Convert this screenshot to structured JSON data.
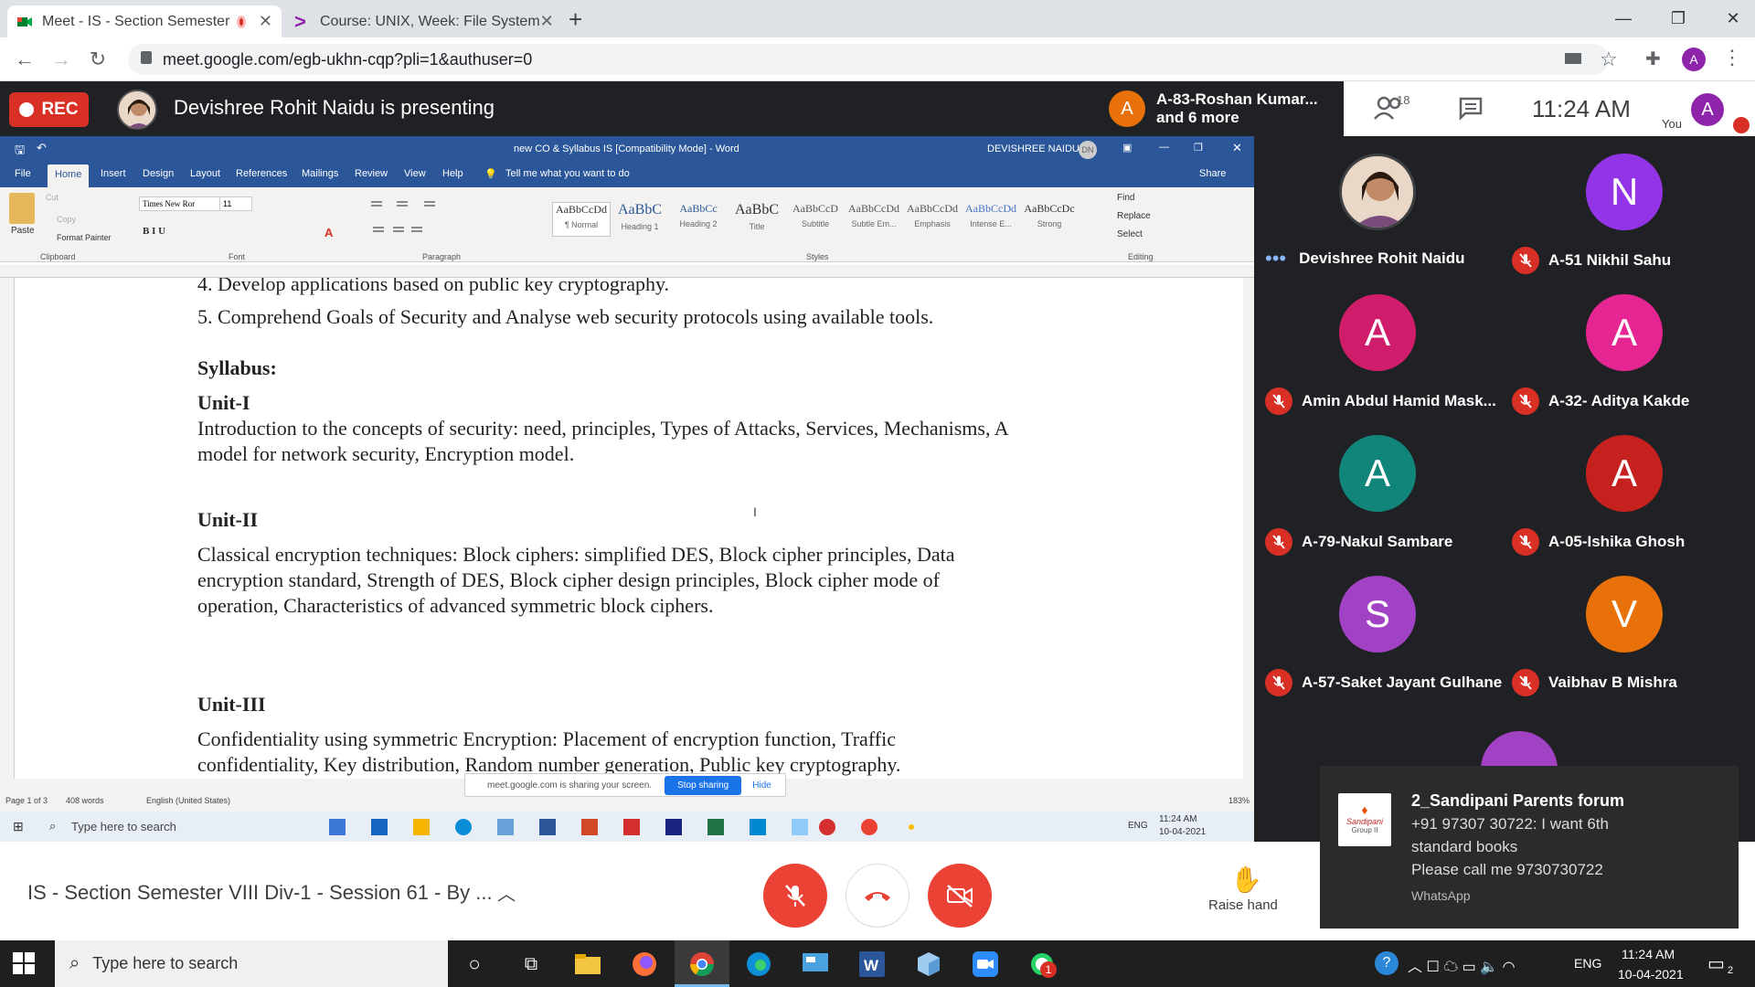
{
  "browser": {
    "tabs": [
      {
        "label": "Meet - IS - Section Semester",
        "active": true
      },
      {
        "label": "Course: UNIX, Week: File System",
        "active": false
      }
    ],
    "new_tab": "+",
    "url": "meet.google.com/egb-ukhn-cqp?pli=1&authuser=0",
    "profile_initial": "A"
  },
  "meet": {
    "rec_label": "REC",
    "presenter_text": "Devishree Rohit Naidu is presenting",
    "joiner_initial": "A",
    "joiner_line1": "A-83-Roshan Kumar...",
    "joiner_line2": "and 6 more",
    "participant_count": "18",
    "time": "11:24 AM",
    "you_label": "You",
    "you_initial": "A",
    "meeting_title": "IS - Section Semester VIII Div-1 - Session 61 - By ...",
    "raise_hand": "Raise hand",
    "participants": [
      {
        "name": "Devishree Rohit Naidu",
        "initial": "",
        "color": "#c9a58b",
        "muted": false
      },
      {
        "name": "A-51 Nikhil Sahu",
        "initial": "N",
        "color": "#9334e6",
        "muted": true
      },
      {
        "name": "Amin Abdul Hamid Mask...",
        "initial": "A",
        "color": "#d01d6b",
        "muted": true
      },
      {
        "name": "A-32- Aditya Kakde",
        "initial": "A",
        "color": "#e52592",
        "muted": true
      },
      {
        "name": "A-79-Nakul Sambare",
        "initial": "A",
        "color": "#12857a",
        "muted": true
      },
      {
        "name": "A-05-Ishika Ghosh",
        "initial": "A",
        "color": "#c5221f",
        "muted": true
      },
      {
        "name": "A-57-Saket Jayant Gulhane",
        "initial": "S",
        "color": "#a142c4",
        "muted": true
      },
      {
        "name": "Vaibhav B Mishra",
        "initial": "V",
        "color": "#e8710a",
        "muted": true
      }
    ]
  },
  "word": {
    "title": "new CO & Syllabus IS [Compatibility Mode] - Word",
    "user": "DEVISHREE NAIDU",
    "user_initials": "DN",
    "share_label": "Share",
    "tabs": [
      "File",
      "Home",
      "Insert",
      "Design",
      "Layout",
      "References",
      "Mailings",
      "Review",
      "View",
      "Help"
    ],
    "tell_me": "Tell me what you want to do",
    "clipboard": {
      "paste": "Paste",
      "cut": "Cut",
      "copy": "Copy",
      "format_painter": "Format Painter",
      "group": "Clipboard"
    },
    "font": {
      "name": "Times New Ror",
      "size": "11",
      "group": "Font"
    },
    "paragraph_group": "Paragraph",
    "styles": [
      {
        "sample": "AaBbCcDd",
        "label": "¶ Normal"
      },
      {
        "sample": "AaBbC",
        "label": "Heading 1"
      },
      {
        "sample": "AaBbCc",
        "label": "Heading 2"
      },
      {
        "sample": "AaBbC",
        "label": "Title"
      },
      {
        "sample": "AaBbCcD",
        "label": "Subtitle"
      },
      {
        "sample": "AaBbCcDd",
        "label": "Subtle Em..."
      },
      {
        "sample": "AaBbCcDd",
        "label": "Emphasis"
      },
      {
        "sample": "AaBbCcDd",
        "label": "Intense E..."
      },
      {
        "sample": "AaBbCcDc",
        "label": "Strong"
      }
    ],
    "styles_group": "Styles",
    "editing": {
      "find": "Find",
      "replace": "Replace",
      "select": "Select",
      "group": "Editing"
    },
    "doc": {
      "line_top": "4.    Develop  applications based  on public  key cryptography.",
      "line5": "5.   Comprehend Goals of Security and Analyse web security protocols  using available  tools.",
      "syllabus": "Syllabus:",
      "unit1": "Unit-I",
      "unit1_text1": "Introduction  to the concepts  of security: need,  principles,  Types of Attacks, Services, Mechanisms, A",
      "unit1_text2": "model  for network security, Encryption model.",
      "unit2": "Unit-II",
      "unit2_text1": "Classical  encryption  techniques:  Block  ciphers:   simplified  DES,  Block  cipher  principles,   Data",
      "unit2_text2": "encryption  standard,   Strength  of  DES,  Block  cipher  design  principles,   Block  cipher  mode  of",
      "unit2_text3": "operation, Characteristics  of advanced symmetric  block ciphers.",
      "unit3": "Unit-III",
      "unit3_text1": "Confidentiality  using  symmetric  Encryption:  Placement   of encryption   function,  Traffic",
      "unit3_text2": "confidentiality,  Key distribution,  Random  number  generation,  Public key cryptography."
    },
    "status": {
      "page": "Page 1 of 3",
      "words": "408 words",
      "language": "English (United States)",
      "zoom": "183%"
    },
    "sharing_text": "meet.google.com is sharing your screen.",
    "stop_sharing": "Stop sharing",
    "hide": "Hide",
    "inner_taskbar": {
      "search": "Type here to search",
      "lang": "ENG",
      "time": "11:24 AM",
      "date": "10-04-2021"
    }
  },
  "notification": {
    "title": "2_Sandipani Parents forum",
    "line1": "+91 97307 30722: I want 6th",
    "line2": "standard books",
    "line3": "Please call me 9730730722",
    "app": "WhatsApp",
    "logo_text": "Sandipani",
    "logo_sub": "Group II"
  },
  "taskbar": {
    "search": "Type here to search",
    "lang": "ENG",
    "time": "11:24 AM",
    "date": "10-04-2021",
    "notif_count": "2",
    "whatsapp_badge": "1"
  }
}
